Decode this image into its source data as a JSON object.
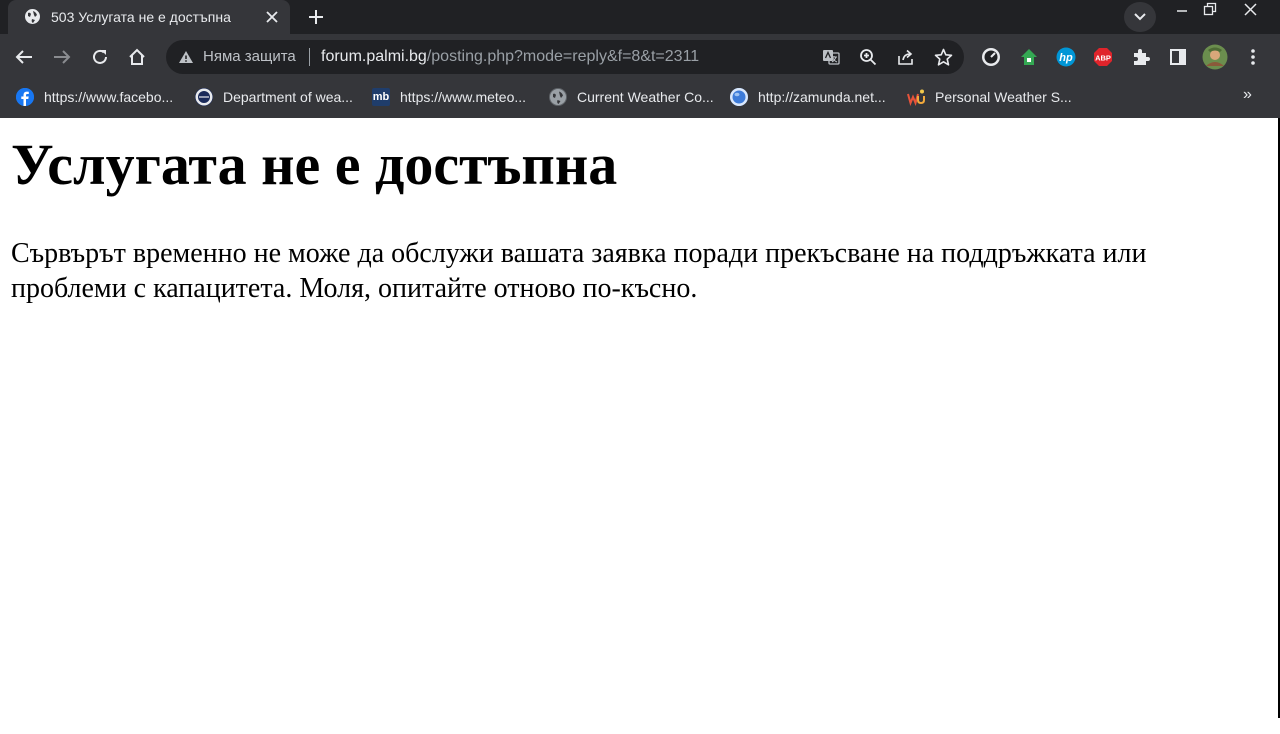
{
  "browser": {
    "tab": {
      "title": "503 Услугата не е достъпна",
      "favicon": "globe-icon"
    },
    "window_controls": [
      "minimize-icon",
      "restore-icon",
      "close-icon"
    ],
    "omnibox": {
      "security_label": "Няма защита",
      "url_host": "forum.palmi.bg",
      "url_path": "/posting.php?mode=reply&f=8&t=2311"
    },
    "toolbar_icons": [
      "back-icon",
      "forward-icon",
      "reload-icon",
      "home-icon"
    ],
    "omnibox_icons": [
      "translate-icon",
      "zoom-icon",
      "share-icon",
      "bookmark-star-icon"
    ],
    "extension_icons": [
      "speed-extension-icon",
      "house-extension-icon",
      "hp-extension-icon",
      "adblock-plus-icon",
      "puzzle-extensions-icon",
      "side-panel-icon",
      "profile-avatar",
      "menu-dots-icon"
    ],
    "adblock_label": "ABP",
    "hp_label": "hp",
    "bookmarks": [
      {
        "label": "https://www.facebo...",
        "icon": "facebook-icon",
        "color": "#1877f2"
      },
      {
        "label": "Department of wea...",
        "icon": "department-icon",
        "color": "#1a2a5a"
      },
      {
        "label": "https://www.meteo...",
        "icon": "meteoblue-icon",
        "icon_text": "mb",
        "color": "#1f3d6b"
      },
      {
        "label": "Current Weather Co...",
        "icon": "globe-icon",
        "color": "#5f6368"
      },
      {
        "label": "http://zamunda.net...",
        "icon": "zamunda-icon",
        "color": "#3d7bd9"
      },
      {
        "label": "Personal Weather S...",
        "icon": "wunderground-icon",
        "icon_text": "wu",
        "color": "#e8533a"
      }
    ],
    "bookmarks_more": "»"
  },
  "page": {
    "heading": "Услугата не е достъпна",
    "message": "Сървърът временно не може да обслужи вашата заявка поради прекъсване на поддръжката или проблеми с капацитета. Моля, опитайте отново по-късно."
  },
  "colors": {
    "tabstrip": "#202124",
    "toolbar": "#35363a",
    "omnibox": "#202124",
    "page_bg": "#ffffff"
  }
}
